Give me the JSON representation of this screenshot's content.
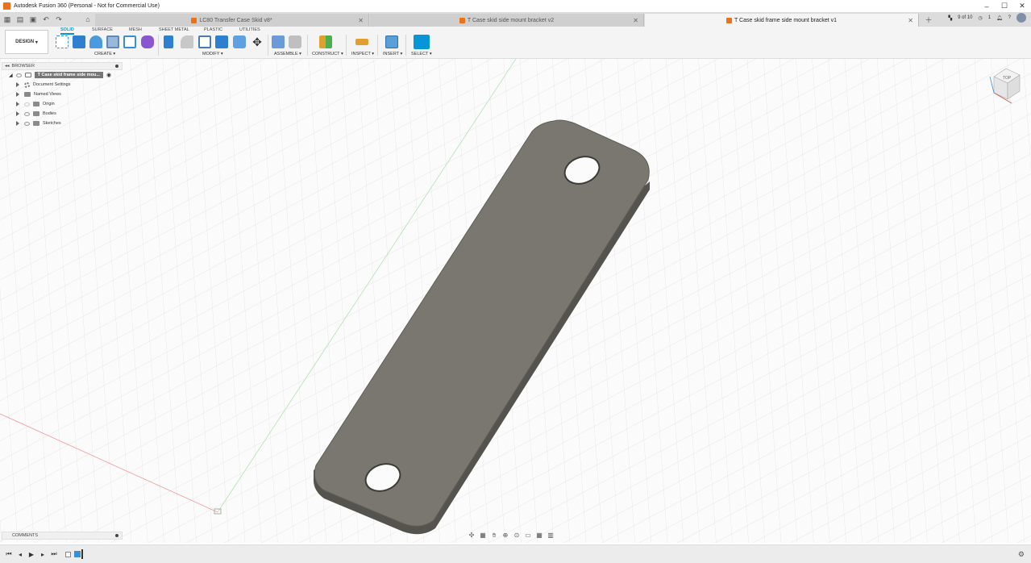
{
  "window": {
    "title": "Autodesk Fusion 360 (Personal - Not for Commercial Use)",
    "minimize": "–",
    "maximize": "☐",
    "close": "✕"
  },
  "tabs": [
    {
      "label": "LC80 Transfer Case Skid v8*",
      "active": false
    },
    {
      "label": "T Case skid side mount bracket v2",
      "active": false
    },
    {
      "label": "T Case skid frame side mount bracket v1",
      "active": true
    }
  ],
  "tabbar_right": {
    "job_status": "9 of 10",
    "notifications_count": "1"
  },
  "toolbar": {
    "workspace": "DESIGN",
    "workspace_tabs": [
      "SOLID",
      "SURFACE",
      "MESH",
      "SHEET METAL",
      "PLASTIC",
      "UTILITIES"
    ],
    "groups": [
      "CREATE",
      "MODIFY",
      "ASSEMBLE",
      "CONSTRUCT",
      "INSPECT",
      "INSERT",
      "SELECT"
    ]
  },
  "browser": {
    "header": "BROWSER",
    "root": "T Case skid frame side mou...",
    "items": [
      "Document Settings",
      "Named Views",
      "Origin",
      "Bodies",
      "Sketches"
    ]
  },
  "comments": {
    "header": "COMMENTS"
  },
  "viewcube": {
    "face": "TOP"
  },
  "colors": {
    "accent": "#0696d7",
    "part_body": "#7a7770",
    "part_edge": "#55534e",
    "grid": "#e3e3e3",
    "x_axis": "#e89090",
    "y_axis": "#a0d8a0"
  }
}
